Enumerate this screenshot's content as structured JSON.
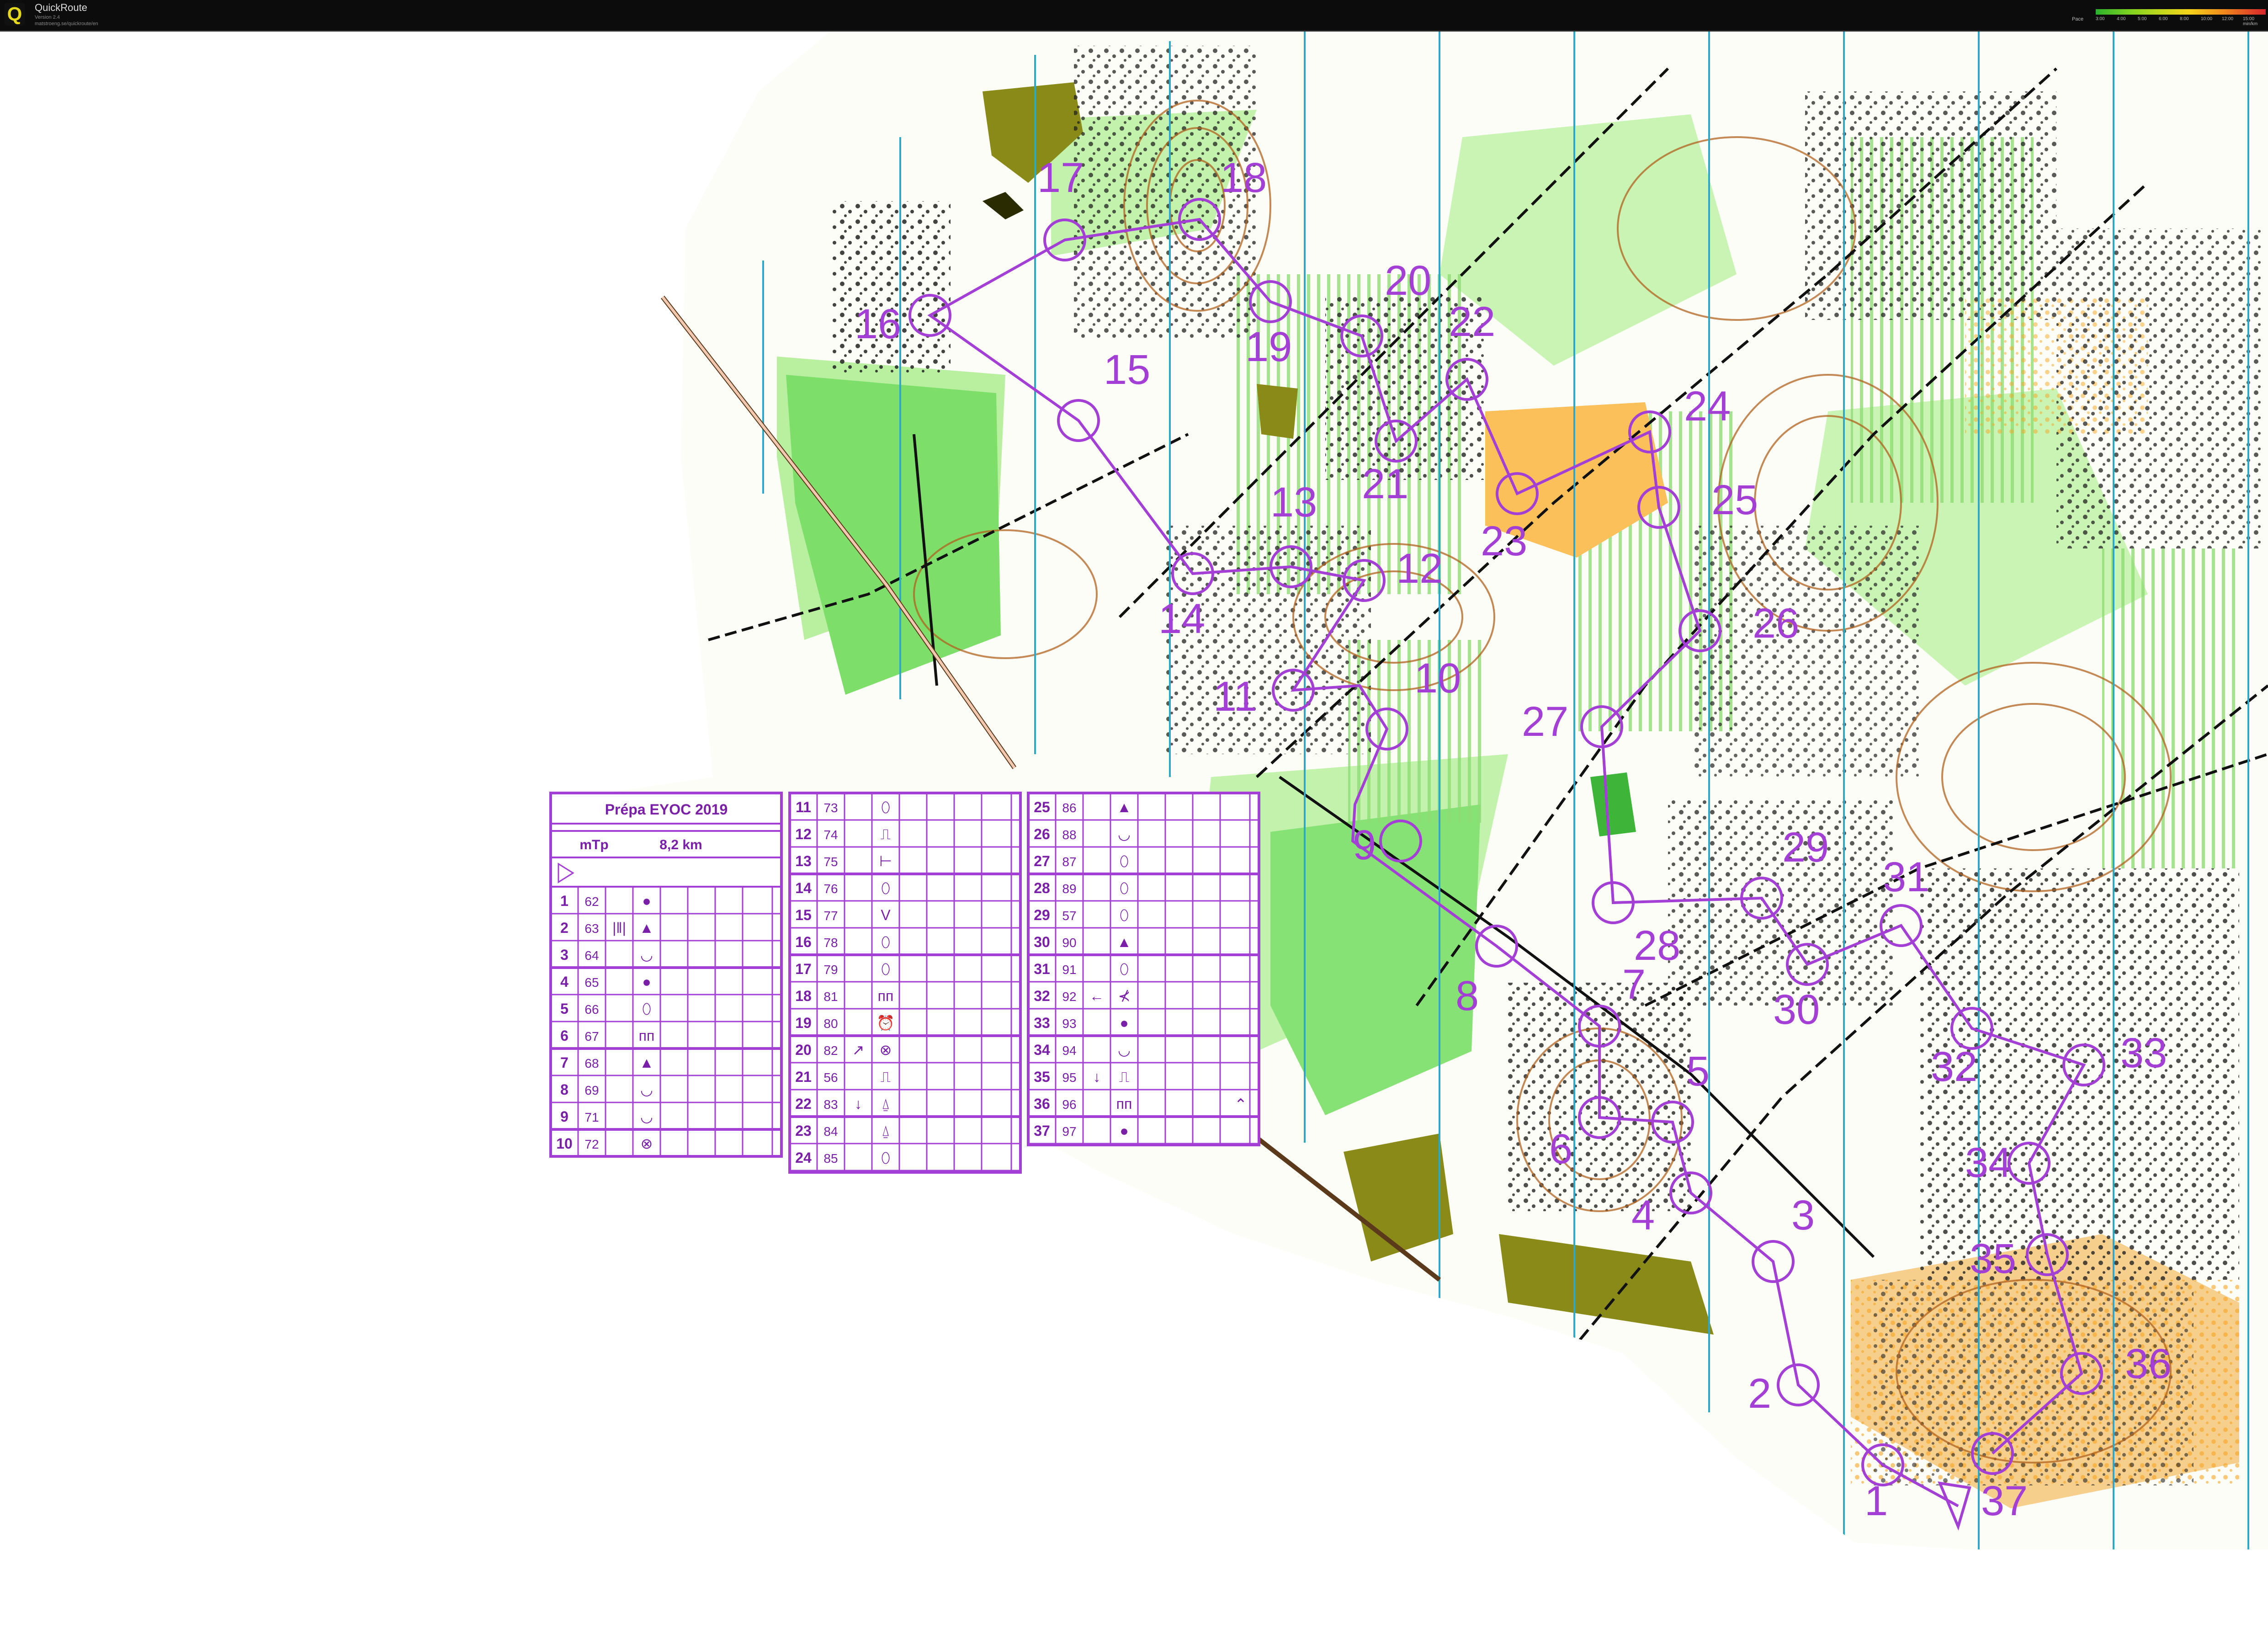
{
  "app": {
    "title": "QuickRoute",
    "version": "Version 2.4",
    "url": "matstroeng.se/quickroute/en"
  },
  "pace_legend": {
    "label": "Pace",
    "ticks": [
      "3:00",
      "4:00",
      "5:00",
      "6:00",
      "8:00",
      "10:00",
      "12:00",
      "15:00 min/km"
    ]
  },
  "map": {
    "course_color": "#a43fd6",
    "controls": [
      {
        "n": "1",
        "code": "62"
      },
      {
        "n": "2",
        "code": "63"
      },
      {
        "n": "3",
        "code": "64"
      },
      {
        "n": "4",
        "code": "65"
      },
      {
        "n": "5",
        "code": "66"
      },
      {
        "n": "6",
        "code": "67"
      },
      {
        "n": "7",
        "code": "68"
      },
      {
        "n": "8",
        "code": "69"
      },
      {
        "n": "9",
        "code": "71"
      },
      {
        "n": "10",
        "code": "72"
      },
      {
        "n": "11",
        "code": "73"
      },
      {
        "n": "12",
        "code": "74"
      },
      {
        "n": "13",
        "code": "75"
      },
      {
        "n": "14",
        "code": "76"
      },
      {
        "n": "15",
        "code": "77"
      },
      {
        "n": "16",
        "code": "78"
      },
      {
        "n": "17",
        "code": "79"
      },
      {
        "n": "18",
        "code": "81"
      },
      {
        "n": "19",
        "code": "80"
      },
      {
        "n": "20",
        "code": "82"
      },
      {
        "n": "21",
        "code": "56"
      },
      {
        "n": "22",
        "code": "83"
      },
      {
        "n": "23",
        "code": "84"
      },
      {
        "n": "24",
        "code": "85"
      },
      {
        "n": "25",
        "code": "86"
      },
      {
        "n": "26",
        "code": "88"
      },
      {
        "n": "27",
        "code": "87"
      },
      {
        "n": "28",
        "code": "89"
      },
      {
        "n": "29",
        "code": "57"
      },
      {
        "n": "30",
        "code": "90"
      },
      {
        "n": "31",
        "code": "91"
      },
      {
        "n": "32",
        "code": "92"
      },
      {
        "n": "33",
        "code": "93"
      },
      {
        "n": "34",
        "code": "94"
      },
      {
        "n": "35",
        "code": "95"
      },
      {
        "n": "36",
        "code": "96"
      },
      {
        "n": "37",
        "code": "97"
      }
    ]
  },
  "description_sheet": {
    "title": "Prépa EYOC 2019",
    "class": "mTp",
    "length": "8,2 km",
    "col1": [
      {
        "n": "1",
        "code": "62",
        "d": "●"
      },
      {
        "n": "2",
        "code": "63",
        "c": "|‖|",
        "d": "▲"
      },
      {
        "n": "3",
        "code": "64",
        "d": "◡"
      },
      {
        "n": "4",
        "code": "65",
        "d": "●"
      },
      {
        "n": "5",
        "code": "66",
        "d": "⬯"
      },
      {
        "n": "6",
        "code": "67",
        "d": "ᴨᴨ"
      },
      {
        "n": "7",
        "code": "68",
        "d": "▲"
      },
      {
        "n": "8",
        "code": "69",
        "d": "◡"
      },
      {
        "n": "9",
        "code": "71",
        "d": "◡"
      },
      {
        "n": "10",
        "code": "72",
        "d": "⊗"
      }
    ],
    "col2": [
      {
        "n": "11",
        "code": "73",
        "d": "⬯"
      },
      {
        "n": "12",
        "code": "74",
        "d": "⎍"
      },
      {
        "n": "13",
        "code": "75",
        "d": "⊢"
      },
      {
        "n": "14",
        "code": "76",
        "d": "⬯"
      },
      {
        "n": "15",
        "code": "77",
        "d": "V"
      },
      {
        "n": "16",
        "code": "78",
        "d": "⬯"
      },
      {
        "n": "17",
        "code": "79",
        "d": "⬯"
      },
      {
        "n": "18",
        "code": "81",
        "d": "ᴨᴨ"
      },
      {
        "n": "19",
        "code": "80",
        "d": "⏰"
      },
      {
        "n": "20",
        "code": "82",
        "c": "↗",
        "d": "⊗"
      },
      {
        "n": "21",
        "code": "56",
        "d": "⎍"
      },
      {
        "n": "22",
        "code": "83",
        "c": "↓",
        "d": "⍙"
      },
      {
        "n": "23",
        "code": "84",
        "d": "⍙"
      },
      {
        "n": "24",
        "code": "85",
        "d": "⬯"
      }
    ],
    "col3": [
      {
        "n": "25",
        "code": "86",
        "d": "▲"
      },
      {
        "n": "26",
        "code": "88",
        "d": "◡"
      },
      {
        "n": "27",
        "code": "87",
        "d": "⬯"
      },
      {
        "n": "28",
        "code": "89",
        "d": "⬯"
      },
      {
        "n": "29",
        "code": "57",
        "d": "⬯"
      },
      {
        "n": "30",
        "code": "90",
        "d": "▲"
      },
      {
        "n": "31",
        "code": "91",
        "d": "⬯"
      },
      {
        "n": "32",
        "code": "92",
        "c": "←",
        "d": "⊀"
      },
      {
        "n": "33",
        "code": "93",
        "d": "●"
      },
      {
        "n": "34",
        "code": "94",
        "d": "◡"
      },
      {
        "n": "35",
        "code": "95",
        "c": "↓",
        "d": "⎍"
      },
      {
        "n": "36",
        "code": "96",
        "d": "ᴨᴨ",
        "g": "⌃"
      },
      {
        "n": "37",
        "code": "97",
        "d": "●"
      }
    ]
  }
}
